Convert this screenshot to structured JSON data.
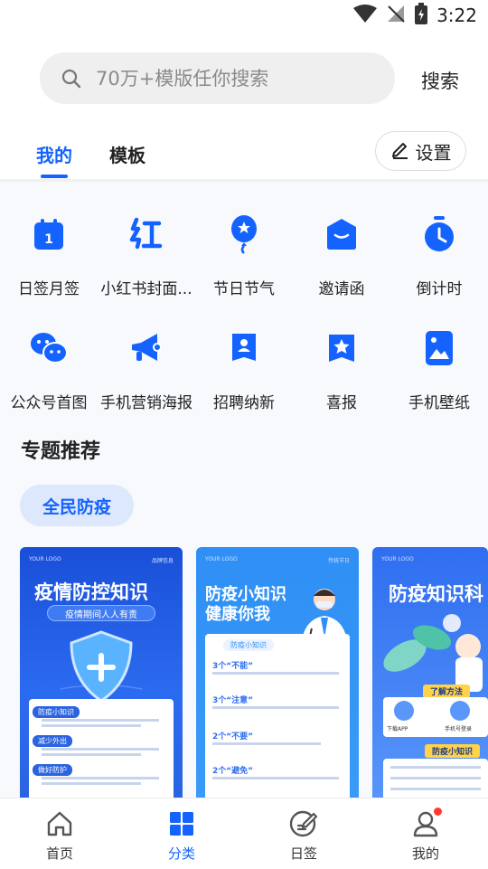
{
  "status_bar": {
    "time": "3:22"
  },
  "search": {
    "placeholder": "70万+模版任你搜索",
    "button_label": "搜索"
  },
  "tabs": [
    {
      "label": "我的"
    },
    {
      "label": "模板"
    }
  ],
  "settings_label": "设置",
  "categories": [
    {
      "label": "日签月签",
      "icon": "calendar-icon"
    },
    {
      "label": "小红书封面...",
      "icon": "xiaohongshu-icon"
    },
    {
      "label": "节日节气",
      "icon": "balloon-icon"
    },
    {
      "label": "邀请函",
      "icon": "envelope-icon"
    },
    {
      "label": "倒计时",
      "icon": "stopwatch-icon"
    },
    {
      "label": "公众号首图",
      "icon": "wechat-icon"
    },
    {
      "label": "手机营销海报",
      "icon": "megaphone-icon"
    },
    {
      "label": "招聘纳新",
      "icon": "recruit-badge-icon"
    },
    {
      "label": "喜报",
      "icon": "star-banner-icon"
    },
    {
      "label": "手机壁纸",
      "icon": "wallpaper-icon"
    }
  ],
  "section_title": "专题推荐",
  "topic_chip": "全民防疫",
  "cards": [
    {
      "brand_left": "YOUR LOGO",
      "brand_right": "品牌信息",
      "title": "疫情防控知识",
      "subtitle": "疫情期间人人有责",
      "items": [
        "防疫小知识",
        "减少外出",
        "做好防护"
      ]
    },
    {
      "brand_left": "YOUR LOGO",
      "brand_right": "传统节日",
      "title_line1": "防疫小知识",
      "title_line2": "健康你我",
      "tag": "防疫小知识",
      "items": [
        "3个“不能”",
        "3个“注意”",
        "2个“不要”",
        "2个“避免”"
      ]
    },
    {
      "brand_left": "YOUR LOGO",
      "title": "防疫知识科",
      "box1": "了解方法",
      "btn1": "下载APP",
      "btn2": "手机号登录",
      "box2": "防疫小知识"
    }
  ],
  "bottom_nav": [
    {
      "label": "首页",
      "icon": "home-icon",
      "active": false
    },
    {
      "label": "分类",
      "icon": "grid-icon",
      "active": true
    },
    {
      "label": "日签",
      "icon": "sign-icon",
      "active": false
    },
    {
      "label": "我的",
      "icon": "profile-icon",
      "active": false
    }
  ],
  "colors": {
    "accent": "#1463ff",
    "chip_bg": "#dde8fc",
    "badge": "#ff3b30"
  }
}
